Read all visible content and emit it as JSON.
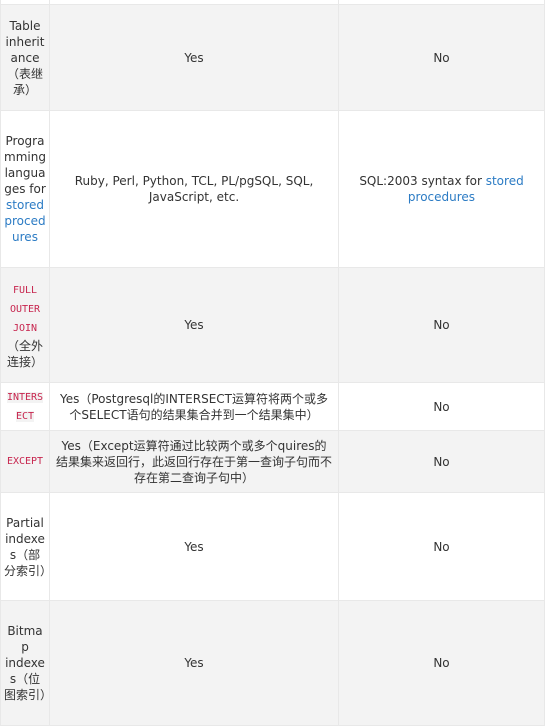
{
  "table": {
    "rows": [
      {
        "feature": {
          "text": "",
          "link": "",
          "code": "",
          "suffix": ""
        },
        "postgresql": "",
        "other": "",
        "shade": "white",
        "height": 6
      },
      {
        "feature": {
          "text": "Table inheritance（表继承）",
          "link": "",
          "code": "",
          "suffix": ""
        },
        "postgresql": "Yes",
        "other": "No",
        "shade": "gray"
      },
      {
        "feature": {
          "text": "Programming languages for ",
          "link": "stored procedures",
          "code": "",
          "suffix": ""
        },
        "postgresql": "Ruby, Perl, Python, TCL, PL/pgSQL, SQL, JavaScript, etc.",
        "other_prefix": "SQL:2003 syntax for ",
        "other_link": "stored procedures",
        "shade": "white"
      },
      {
        "feature": {
          "text": "",
          "link": "",
          "code": "FULL OUTER JOIN",
          "suffix": "（全外连接）"
        },
        "postgresql": "Yes",
        "other": "No",
        "shade": "gray"
      },
      {
        "feature": {
          "text": "",
          "link": "",
          "code": "INTERSECT",
          "suffix": ""
        },
        "postgresql": "Yes（Postgresql的INTERSECT运算符将两个或多个SELECT语句的结果集合并到一个结果集中）",
        "other": "No",
        "shade": "white"
      },
      {
        "feature": {
          "text": "",
          "link": "",
          "code": "EXCEPT",
          "suffix": ""
        },
        "postgresql": "Yes（Except运算符通过比较两个或多个quires的结果集来返回行，此返回行存在于第一查询子句而不存在第二查询子句中）",
        "other": "No",
        "shade": "gray"
      },
      {
        "feature": {
          "text": "Partial indexes（部分索引）",
          "link": "",
          "code": "",
          "suffix": ""
        },
        "postgresql": "Yes",
        "other": "No",
        "shade": "white"
      },
      {
        "feature": {
          "text": "Bitmap indexes（位图索引）",
          "link": "",
          "code": "",
          "suffix": ""
        },
        "postgresql": "Yes",
        "other": "No",
        "shade": "gray"
      }
    ]
  },
  "colors": {
    "link": "#2b7bc4",
    "code_text": "#c7254e",
    "row_gray": "#f3f3f3",
    "border": "#e8e8e8",
    "text": "#333333"
  }
}
